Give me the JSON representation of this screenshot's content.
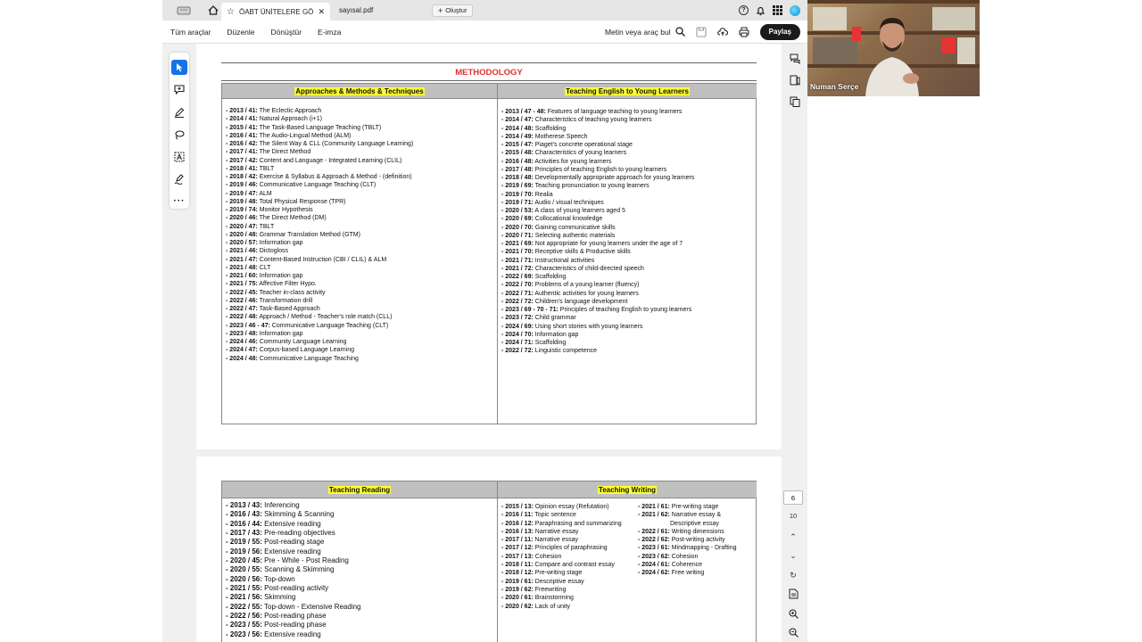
{
  "tabs": {
    "active": "ÖABT ÜNİTELERE GÖR...",
    "inactive": "sayısal.pdf",
    "new_tab": "Oluştur"
  },
  "menu": {
    "items": [
      "Tüm araçlar",
      "Düzenle",
      "Dönüştür",
      "E-imza"
    ],
    "search": "Metin veya araç bul",
    "share": "Paylaş"
  },
  "pager": {
    "current": "6",
    "total": "10"
  },
  "webcam": {
    "name": "Numan Serçe"
  },
  "page1": {
    "title": "METHODOLOGY",
    "left_header": "Approaches & Methods & Techniques",
    "right_header": "Teaching English to Young Learners",
    "left_entries": [
      {
        "k": "- 2013 / 41:",
        "v": " The Eclectic Approach"
      },
      {
        "k": "- 2014 / 41:",
        "v": " Natural Approach (i+1)"
      },
      {
        "k": "- 2015 / 41:",
        "v": " The Task-Based Language Teaching (TBLT)"
      },
      {
        "k": "- 2016 / 41:",
        "v": " The Audio-Lingual Method (ALM)"
      },
      {
        "k": "- 2016 / 42:",
        "v": " The Silent Way & CLL (Community Language Learning)"
      },
      {
        "k": "- 2017 / 41:",
        "v": " The Direct Method"
      },
      {
        "k": "- 2017 / 42:",
        "v": " Content and Language - Integrated Learning (CLIL)"
      },
      {
        "k": "- 2018 / 41:",
        "v": " TBLT"
      },
      {
        "k": "- 2018 / 42:",
        "v": " Exercise & Syllabus & Approach & Method - (definition)"
      },
      {
        "k": "- 2019 / 46:",
        "v": " Communicative Language Teaching (CLT)"
      },
      {
        "k": "- 2019 / 47:",
        "v": " ALM"
      },
      {
        "k": "- 2019 / 48:",
        "v": " Total Physical Response (TPR)"
      },
      {
        "k": "- 2019 / 74:",
        "v": " Monitor Hypothesis"
      },
      {
        "k": "- 2020 / 46:",
        "v": " The Direct Method (DM)"
      },
      {
        "k": "- 2020 / 47:",
        "v": " TBLT"
      },
      {
        "k": "- 2020 / 48:",
        "v": " Grammar Translation Method (GTM)"
      },
      {
        "k": "- 2020 / 57:",
        "v": " Information gap"
      },
      {
        "k": "- 2021 / 46:",
        "v": " Dictogloss"
      },
      {
        "k": "- 2021 / 47:",
        "v": " Content-Based Instruction (CBI / CLIL) & ALM"
      },
      {
        "k": "- 2021 / 48:",
        "v": " CLT"
      },
      {
        "k": "- 2021 / 60:",
        "v": " Information gap"
      },
      {
        "k": "- 2021 / 75:",
        "v": " Affective Filter Hypo."
      },
      {
        "k": "- 2022 / 45:",
        "v": " Teacher in-class activity"
      },
      {
        "k": "- 2022 / 46:",
        "v": " Transformation drill"
      },
      {
        "k": "- 2022 / 47:",
        "v": " Task-Based Approach"
      },
      {
        "k": "- 2022 / 48:",
        "v": " Approach / Method - Teacher's role match (CLL)"
      },
      {
        "k": "- 2023 / 46 - 47:",
        "v": " Communicative Language Teaching (CLT)"
      },
      {
        "k": "- 2023 / 48:",
        "v": " Information gap"
      },
      {
        "k": "- 2024 / 46:",
        "v": " Community Language Learning"
      },
      {
        "k": "- 2024 / 47:",
        "v": " Corpus-based Language Learning"
      },
      {
        "k": "- 2024 / 48:",
        "v": " Communicative Language Teaching"
      }
    ],
    "right_entries": [
      {
        "k": "- 2013 / 47 - 48:",
        "v": " Features of language teaching to young learners"
      },
      {
        "k": "- 2014 / 47:",
        "v": " Characteristics of teaching young learners"
      },
      {
        "k": "- 2014 / 48:",
        "v": " Scaffolding"
      },
      {
        "k": "- 2014 / 49:",
        "v": " Motherese Speech"
      },
      {
        "k": "- 2015 / 47:",
        "v": " Piaget's concrete operational stage"
      },
      {
        "k": "- 2015 / 48:",
        "v": " Characteristics of young learners"
      },
      {
        "k": "- 2016 / 48:",
        "v": " Activities for young learners"
      },
      {
        "k": "- 2017 / 48:",
        "v": " Principles of teaching English to young learners"
      },
      {
        "k": "- 2018 / 48:",
        "v": " Developmentally appropriate approach for young learners"
      },
      {
        "k": "- 2019 / 69:",
        "v": " Teaching pronunciation to young learners"
      },
      {
        "k": "- 2019 / 70:",
        "v": " Realia"
      },
      {
        "k": "- 2019 / 71:",
        "v": " Audio / visual techniques"
      },
      {
        "k": "- 2020 / 53:",
        "v": " A class of young learners aged 5"
      },
      {
        "k": "- 2020 / 69:",
        "v": " Collocational knowledge"
      },
      {
        "k": "- 2020 / 70:",
        "v": " Gaining communicative skills"
      },
      {
        "k": "- 2020 / 71:",
        "v": " Selecting authentic materials"
      },
      {
        "k": "- 2021 / 69:",
        "v": " Not appropriate for young learners under the age of 7"
      },
      {
        "k": "- 2021 / 70:",
        "v": " Receptive skills & Productive skills"
      },
      {
        "k": "- 2021 / 71:",
        "v": " Instructional activities"
      },
      {
        "k": "- 2021 / 72:",
        "v": " Characteristics of child-directed speech"
      },
      {
        "k": "- 2022 / 69:",
        "v": " Scaffolding"
      },
      {
        "k": "- 2022 / 70:",
        "v": " Problems of a young learner (fluency)"
      },
      {
        "k": "- 2022 / 71:",
        "v": " Authentic activities for young learners"
      },
      {
        "k": "- 2022 / 72:",
        "v": " Children's language development"
      },
      {
        "k": "- 2023 / 69 - 70 - 71:",
        "v": " Principles of teaching English to young learners"
      },
      {
        "k": "- 2023 / 72:",
        "v": " Child grammar"
      },
      {
        "k": "- 2024 / 69:",
        "v": " Using short stories with young learners"
      },
      {
        "k": "- 2024 / 70:",
        "v": " Information gap"
      },
      {
        "k": "- 2024 / 71:",
        "v": " Scaffolding"
      },
      {
        "k": "- 2022 / 72:",
        "v": " Linguistic competence"
      }
    ]
  },
  "page2": {
    "left_header": "Teaching Reading",
    "right_header": "Teaching Writing",
    "reading_entries": [
      {
        "k": "- 2013 / 43:",
        "v": " Inferencing"
      },
      {
        "k": "- 2016 / 43:",
        "v": " Skimming & Scanning"
      },
      {
        "k": "- 2016 / 44:",
        "v": " Extensive reading"
      },
      {
        "k": "- 2017 / 43:",
        "v": " Pre-reading objectives"
      },
      {
        "k": "- 2019 / 55:",
        "v": " Post-reading stage"
      },
      {
        "k": "- 2019 / 56:",
        "v": " Extensive reading"
      },
      {
        "k": "- 2020 / 45:",
        "v": " Pre - While - Post Reading"
      },
      {
        "k": "- 2020 / 55:",
        "v": " Scanning & Skimming"
      },
      {
        "k": "- 2020 / 56:",
        "v": " Top-down"
      },
      {
        "k": "- 2021 / 55:",
        "v": " Post-reading activity"
      },
      {
        "k": "- 2021 / 56:",
        "v": " Skimming"
      },
      {
        "k": "- 2022 / 55:",
        "v": " Top-down - Extensive Reading"
      },
      {
        "k": "- 2022 / 56:",
        "v": " Post-reading phase"
      },
      {
        "k": "- 2023 / 55:",
        "v": " Post-reading phase"
      },
      {
        "k": "- 2023 / 56:",
        "v": " Extensive reading"
      }
    ],
    "writing_entries_a": [
      {
        "k": "- 2015 / 13:",
        "v": " Opinion essay (Refutation)"
      },
      {
        "k": "- 2016 / 11:",
        "v": " Topic sentence"
      },
      {
        "k": "- 2016 / 12:",
        "v": " Paraphrasing and summarizing"
      },
      {
        "k": "- 2016 / 13:",
        "v": " Narrative essay"
      },
      {
        "k": "- 2017 / 11:",
        "v": " Narrative essay"
      },
      {
        "k": "- 2017 / 12:",
        "v": " Principles of paraphrasing"
      },
      {
        "k": "- 2017 / 13:",
        "v": " Cohesion"
      },
      {
        "k": "- 2018 / 11:",
        "v": " Compare and contrast essay"
      },
      {
        "k": "- 2018 / 12:",
        "v": " Pre-writing stage"
      },
      {
        "k": "- 2019 / 61:",
        "v": " Descriptive essay"
      },
      {
        "k": "- 2019 / 62:",
        "v": " Freewriting"
      },
      {
        "k": "- 2020 / 61:",
        "v": " Brainstorming"
      },
      {
        "k": "- 2020 / 62:",
        "v": " Lack of unity"
      }
    ],
    "writing_entries_b": [
      {
        "k": "- 2021 / 61:",
        "v": " Pre-writing stage"
      },
      {
        "k": "- 2021 / 62:",
        "v": " Narrative essay &"
      },
      {
        "k": "",
        "v": "Descriptive essay"
      },
      {
        "k": "- 2022 / 61:",
        "v": " Writing dimensions"
      },
      {
        "k": "- 2022 / 62:",
        "v": " Post-writing activity"
      },
      {
        "k": "- 2023 / 61:",
        "v": " Mindmapping - Drafting"
      },
      {
        "k": "- 2023 / 62:",
        "v": " Cohesion"
      },
      {
        "k": "- 2024 / 61:",
        "v": " Coherence"
      },
      {
        "k": "- 2024 / 62:",
        "v": " Free writing"
      }
    ]
  }
}
